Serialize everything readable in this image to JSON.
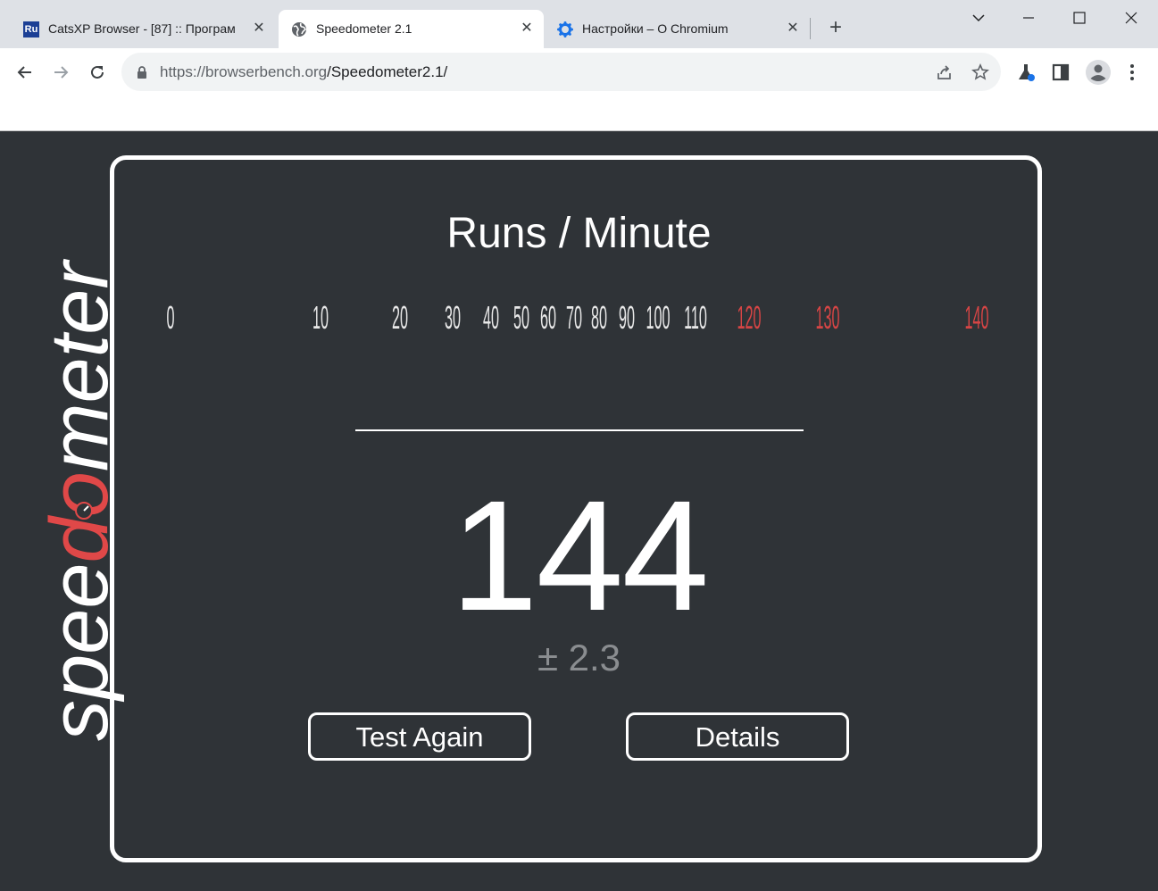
{
  "browser": {
    "tabs": [
      {
        "title": "CatsXP Browser - [87] :: Програм",
        "favicon_text": "Ru",
        "active": false
      },
      {
        "title": "Speedometer 2.1",
        "active": true
      },
      {
        "title": "Настройки – О Chromium",
        "active": false
      }
    ],
    "close_glyph": "✕",
    "newtab_glyph": "+",
    "url_host": "https://browserbench.org",
    "url_path": "/Speedometer2.1/"
  },
  "page": {
    "logo_prefix": "spee",
    "logo_highlight": "do",
    "logo_suffix": "meter",
    "heading": "Runs / Minute",
    "score": "144",
    "margin": "± 2.3",
    "buttons": {
      "test_again": "Test Again",
      "details": "Details"
    }
  },
  "gauge": {
    "value": 144,
    "labels": [
      "0",
      "10",
      "20",
      "30",
      "40",
      "50",
      "60",
      "70",
      "80",
      "90",
      "100",
      "110",
      "120",
      "130",
      "140"
    ],
    "colors": {
      "normal": "#e8e8e8",
      "danger": "#d64545",
      "needle": "#f0901e"
    }
  }
}
